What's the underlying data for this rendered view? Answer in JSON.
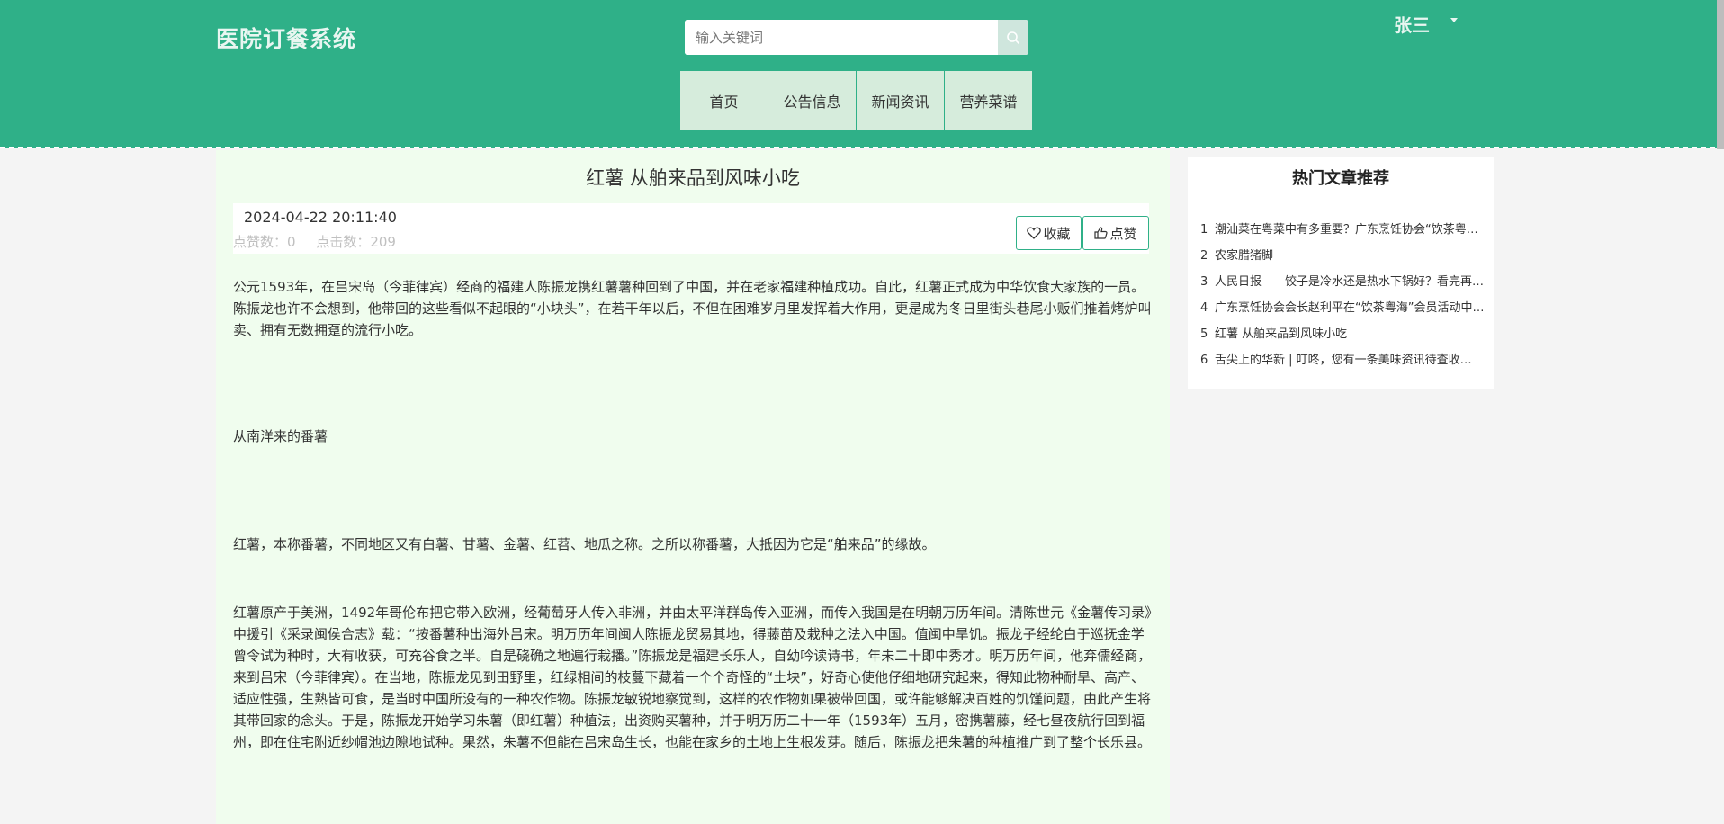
{
  "app": {
    "title": "医院订餐系统"
  },
  "search": {
    "placeholder": "输入关键词",
    "icon": "search-icon"
  },
  "user": {
    "name": "张三",
    "caret_icon": "caret-down-icon"
  },
  "nav": [
    {
      "label": "首页"
    },
    {
      "label": "公告信息"
    },
    {
      "label": "新闻资讯"
    },
    {
      "label": "营养菜谱"
    }
  ],
  "article": {
    "title": "红薯 从舶来品到风味小吃",
    "date": "2024-04-22 20:11:40",
    "likes_label": "点赞数：0",
    "clicks_label": "点击数：209",
    "favorite_label": "收藏",
    "like_label": "点赞",
    "paragraphs": [
      "公元1593年，在吕宋岛（今菲律宾）经商的福建人陈振龙携红薯薯种回到了中国，并在老家福建种植成功。自此，红薯正式成为中华饮食大家族的一员。陈振龙也许不会想到，他带回的这些看似不起眼的“小块头”，在若干年以后，不但在困难岁月里发挥着大作用，更是成为冬日里街头巷尾小贩们推着烤炉叫卖、拥有无数拥趸的流行小吃。",
      "从南洋来的番薯",
      "红薯，本称番薯，不同地区又有白薯、甘薯、金薯、红苕、地瓜之称。之所以称番薯，大抵因为它是“舶来品”的缘故。",
      "红薯原产于美洲，1492年哥伦布把它带入欧洲，经葡萄牙人传入非洲，并由太平洋群岛传入亚洲，而传入我国是在明朝万历年间。清陈世元《金薯传习录》中援引《采录闽侯合志》载：“按番薯种出海外吕宋。明万历年间闽人陈振龙贸易其地，得藤苗及栽种之法入中国。值闽中旱饥。振龙子经纶白于巡抚金学曾令试为种时，大有收获，可充谷食之半。自是硗确之地遍行栽播。”陈振龙是福建长乐人，自幼吟读诗书，年未二十即中秀才。明万历年间，他弃儒经商，来到吕宋（今菲律宾）。在当地，陈振龙见到田野里，红绿相间的枝蔓下藏着一个个奇怪的“土块”，好奇心使他仔细地研究起来，得知此物种耐旱、高产、适应性强，生熟皆可食，是当时中国所没有的一种农作物。陈振龙敏锐地察觉到，这样的农作物如果被带回国，或许能够解决百姓的饥馑问题，由此产生将其带回家的念头。于是，陈振龙开始学习朱薯（即红薯）种植法，出资购买薯种，并于明万历二十一年（1593年）五月，密携薯藤，经七昼夜航行回到福州，即在住宅附近纱帽池边隙地试种。果然，朱薯不但能在吕宋岛生长，也能在家乡的土地上生根发芽。随后，陈振龙把朱薯的种植推广到了整个长乐县。"
    ]
  },
  "sidebar": {
    "title": "热门文章推荐",
    "items": [
      {
        "num": "1",
        "text": "潮汕菜在粤菜中有多重要？广东烹饪协会“饮茶粤海”会员…"
      },
      {
        "num": "2",
        "text": "农家腊猪脚"
      },
      {
        "num": "3",
        "text": "人民日报——饺子是冷水还是热水下锅好？看完再也不…"
      },
      {
        "num": "4",
        "text": "广东烹饪协会会长赵利平在“饮茶粤海”会员活动中…"
      },
      {
        "num": "5",
        "text": "红薯 从舶来品到风味小吃"
      },
      {
        "num": "6",
        "text": "舌尖上的华新 | 叮咚，您有一条美味资讯待查收…"
      }
    ]
  },
  "colors": {
    "header": "#2fb088",
    "main_bg": "#f0fdee",
    "nav_bg": "#d6ecdc"
  }
}
